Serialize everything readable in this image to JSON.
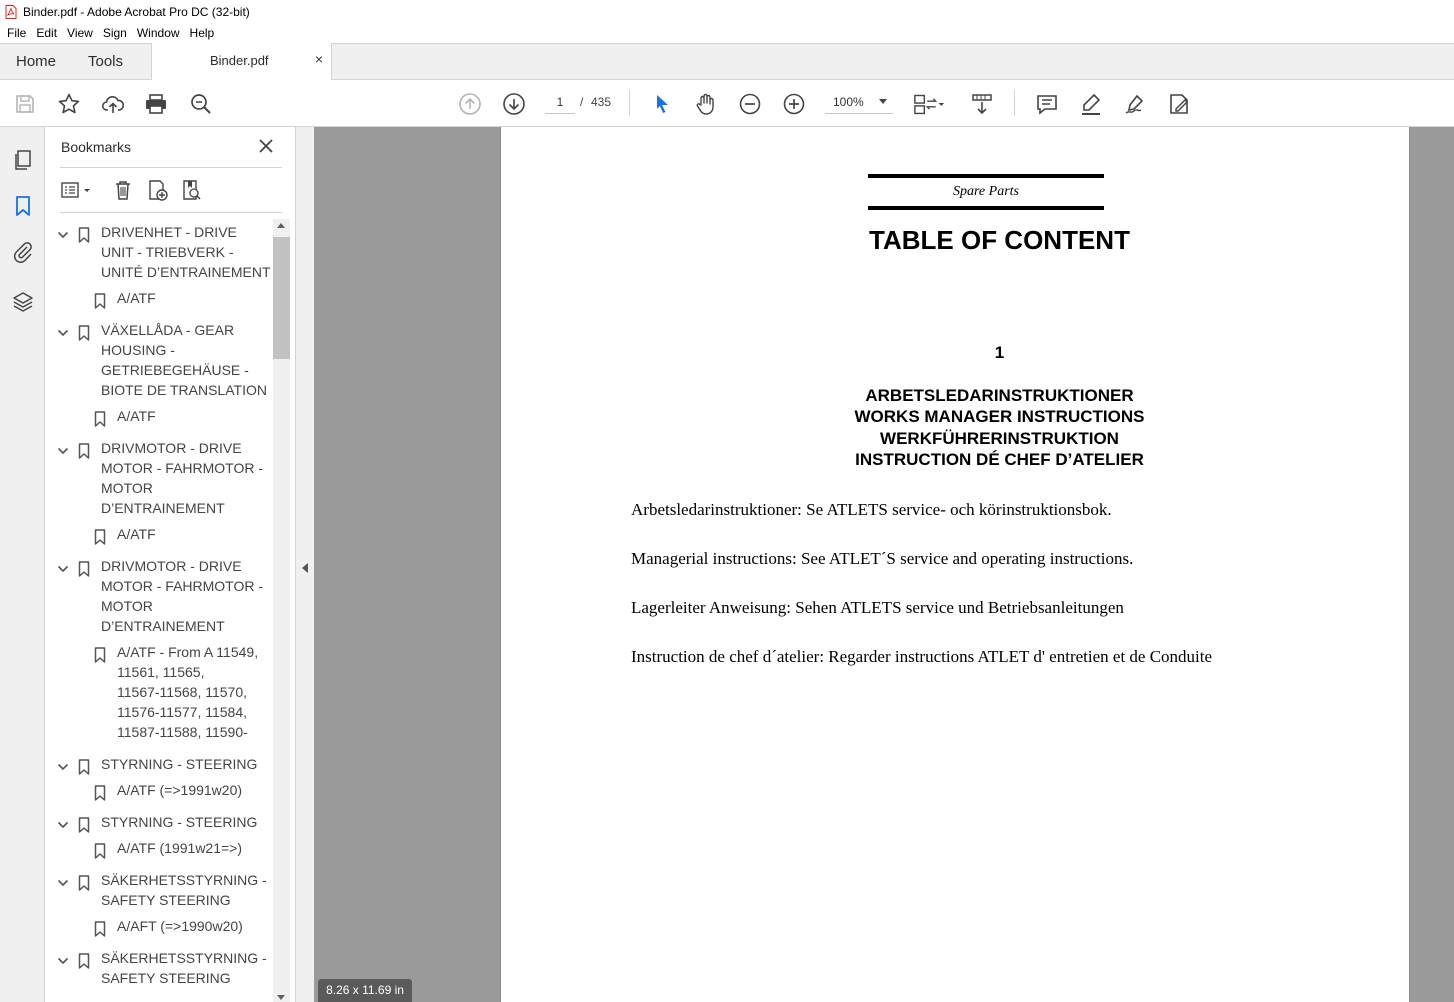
{
  "window": {
    "title": "Binder.pdf - Adobe Acrobat Pro DC (32-bit)"
  },
  "menu": [
    "File",
    "Edit",
    "View",
    "Sign",
    "Window",
    "Help"
  ],
  "tabs": {
    "home": "Home",
    "tools": "Tools",
    "document": "Binder.pdf",
    "close": "×"
  },
  "toolbar": {
    "page_current": "1",
    "page_separator": "/",
    "page_total": "435",
    "zoom": "100%"
  },
  "bookmarks": {
    "title": "Bookmarks",
    "items": [
      {
        "level": 0,
        "lines": [
          "DRIVENHET - DRIVE",
          "UNIT - TRIEBVERK -",
          "UNITÉ D’ENTRAINEMENT"
        ]
      },
      {
        "level": 1,
        "lines": [
          "A/ATF"
        ]
      },
      {
        "level": 0,
        "lines": [
          "VÄXELLÅDA - GEAR",
          "HOUSING -",
          "GETRIEBEGEHÄUSE -",
          "BIOTE DE TRANSLATION"
        ]
      },
      {
        "level": 1,
        "lines": [
          "A/ATF"
        ]
      },
      {
        "level": 0,
        "lines": [
          "DRIVMOTOR - DRIVE",
          "MOTOR - FAHRMOTOR -",
          "MOTOR",
          "D’ENTRAINEMENT"
        ]
      },
      {
        "level": 1,
        "lines": [
          "A/ATF"
        ]
      },
      {
        "level": 0,
        "lines": [
          "DRIVMOTOR - DRIVE",
          "MOTOR - FAHRMOTOR -",
          "MOTOR",
          "D’ENTRAINEMENT"
        ]
      },
      {
        "level": 1,
        "lines": [
          "A/ATF - From A 11549,",
          "11561, 11565,",
          "11567-11568, 11570,",
          "11576-11577, 11584,",
          "11587-11588, 11590-"
        ]
      },
      {
        "level": 0,
        "lines": [
          "STYRNING - STEERING"
        ]
      },
      {
        "level": 1,
        "lines": [
          "A/ATF (=>1991w20)"
        ]
      },
      {
        "level": 0,
        "lines": [
          "STYRNING - STEERING"
        ]
      },
      {
        "level": 1,
        "lines": [
          "A/ATF (1991w21=>)"
        ]
      },
      {
        "level": 0,
        "lines": [
          "SÄKERHETSSTYRNING -",
          "SAFETY STEERING"
        ]
      },
      {
        "level": 1,
        "lines": [
          "A/AFT (=>1990w20)"
        ]
      },
      {
        "level": 0,
        "lines": [
          "SÄKERHETSSTYRNING -",
          "SAFETY STEERING"
        ]
      }
    ]
  },
  "document": {
    "header_label": "Spare Parts",
    "title": "TABLE OF CONTENT",
    "chapter_number": "1",
    "headings": [
      "ARBETSLEDARINSTRUKTIONER",
      "WORKS MANAGER INSTRUCTIONS",
      "WERKFÜHRERINSTRUKTION",
      "INSTRUCTION DÉ CHEF D’ATELIER"
    ],
    "paragraphs": [
      "Arbetsledarinstruktioner: Se ATLETS  service- och körinstruktionsbok.",
      "Managerial instructions:  See ATLET´S  service and operating instructions.",
      "Lagerleiter Anweisung:  Sehen ATLETS  service und Betriebsanleitungen",
      "Instruction de chef d´atelier:  Regarder instructions ATLET d' entretien et de Conduite"
    ]
  },
  "status": {
    "page_size": "8.26 x 11.69 in"
  },
  "colors": {
    "accent_blue": "#1473e6",
    "chrome_gray": "#f0f0f0",
    "doc_background": "#9a9a9a"
  }
}
